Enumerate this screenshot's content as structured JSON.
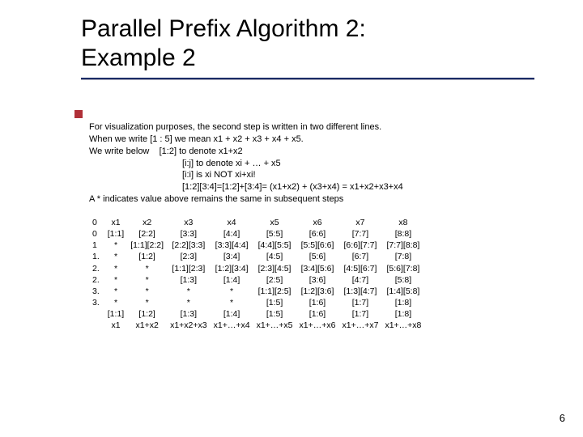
{
  "title": {
    "line1": "Parallel Prefix Algorithm 2:",
    "line2": "Example 2"
  },
  "notation": {
    "p1": "For visualization purposes, the second step is written in two different lines.",
    "p2": "When we write [1 : 5] we mean x1 + x2 + x3 + x4 + x5.",
    "p3a": "We write below",
    "p3b": "[1:2] to denote x1+x2",
    "p4": "[i:j] to denote xi + … + x5",
    "p5": "[i:i] is xi NOT xi+xi!",
    "p6": "[1:2][3:4]=[1:2]+[3:4]= (x1+x2) + (x3+x4) = x1+x2+x3+x4",
    "p7": "A * indicates value above remains the same in subsequent steps"
  },
  "table": {
    "rows": [
      {
        "label": "0",
        "c": [
          "x1",
          "x2",
          "x3",
          "x4",
          "x5",
          "x6",
          "x7",
          "x8"
        ]
      },
      {
        "label": "0",
        "c": [
          "[1:1]",
          "[2:2]",
          "[3:3]",
          "[4:4]",
          "[5:5]",
          "[6:6]",
          "[7:7]",
          "[8:8]"
        ]
      },
      {
        "label": "1",
        "c": [
          "*",
          "[1:1][2:2]",
          "[2:2][3:3]",
          "[3:3][4:4]",
          "[4:4][5:5]",
          "[5:5][6:6]",
          "[6:6][7:7]",
          "[7:7][8:8]"
        ]
      },
      {
        "label": "1.",
        "c": [
          "*",
          "[1:2]",
          "[2:3]",
          "[3:4]",
          "[4:5]",
          "[5:6]",
          "[6:7]",
          "[7:8]"
        ]
      },
      {
        "label": "2.",
        "c": [
          "*",
          "*",
          "[1:1][2:3]",
          "[1:2][3:4]",
          "[2:3][4:5]",
          "[3:4][5:6]",
          "[4:5][6:7]",
          "[5:6][7:8]"
        ]
      },
      {
        "label": "2.",
        "c": [
          "*",
          "*",
          "[1:3]",
          "[1:4]",
          "[2:5]",
          "[3:6]",
          "[4:7]",
          "[5:8]"
        ]
      },
      {
        "label": "3.",
        "c": [
          "*",
          "*",
          "*",
          "*",
          "[1:1][2:5]",
          "[1:2][3:6]",
          "[1:3][4:7]",
          "[1:4][5:8]"
        ]
      },
      {
        "label": "3.",
        "c": [
          "*",
          "*",
          "*",
          "*",
          "[1:5]",
          "[1:6]",
          "[1:7]",
          "[1:8]"
        ]
      },
      {
        "label": "",
        "c": [
          "[1:1]",
          "[1:2]",
          "[1:3]",
          "[1:4]",
          "[1:5]",
          "[1:6]",
          "[1:7]",
          "[1:8]"
        ]
      },
      {
        "label": "",
        "c": [
          "x1",
          "x1+x2",
          "x1+x2+x3",
          "x1+…+x4",
          "x1+…+x5",
          "x1+…+x6",
          "x1+…+x7",
          "x1+…+x8"
        ]
      }
    ]
  },
  "page_number": "6"
}
